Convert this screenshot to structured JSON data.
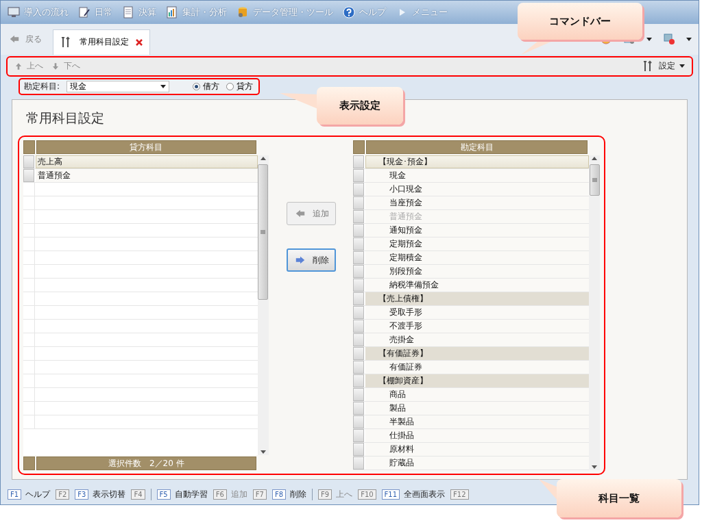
{
  "menu": [
    {
      "kind": "flow",
      "label": "導入の流れ"
    },
    {
      "kind": "daily",
      "label": "日常"
    },
    {
      "kind": "closing",
      "label": "決算"
    },
    {
      "kind": "report",
      "label": "集計・分析"
    },
    {
      "kind": "data",
      "label": "データ管理・ツール"
    },
    {
      "kind": "help",
      "label": "ヘルプ"
    },
    {
      "kind": "play",
      "label": "メニュー"
    }
  ],
  "back": {
    "label": "戻る",
    "disabled": true
  },
  "tab": {
    "label": "常用科目設定",
    "selected": true
  },
  "toolbar": {
    "items": [
      {
        "label": "上へ",
        "kind": "up",
        "disabled": true
      },
      {
        "label": "下へ",
        "kind": "down",
        "disabled": true
      }
    ],
    "settings": "設定"
  },
  "filter": {
    "label": "勘定科目:",
    "value": "現金",
    "radios": [
      {
        "label": "借方",
        "selected": true
      },
      {
        "label": "貸方",
        "selected": false
      }
    ]
  },
  "page_title": "常用科目設定",
  "left_grid": {
    "header": "貸方科目",
    "footer": "選択件数　2／20 件",
    "rows": [
      {
        "label": "売上高",
        "selected": true
      },
      {
        "label": "普通預金",
        "selected": false
      }
    ]
  },
  "actions": [
    {
      "label": "追加",
      "kind": "left",
      "disabled": true,
      "focused": false
    },
    {
      "label": "削除",
      "kind": "right",
      "disabled": false,
      "focused": true
    }
  ],
  "right_grid": {
    "header": "勘定科目",
    "rows": [
      {
        "label": "【現金･預金】",
        "kind": "group",
        "selected": true,
        "disabled": false
      },
      {
        "label": "現金",
        "kind": "account",
        "selected": false,
        "disabled": false
      },
      {
        "label": "小口現金",
        "kind": "account",
        "selected": false,
        "disabled": false
      },
      {
        "label": "当座預金",
        "kind": "account",
        "selected": false,
        "disabled": false
      },
      {
        "label": "普通預金",
        "kind": "account",
        "selected": false,
        "disabled": true
      },
      {
        "label": "通知預金",
        "kind": "account",
        "selected": false,
        "disabled": false
      },
      {
        "label": "定期預金",
        "kind": "account",
        "selected": false,
        "disabled": false
      },
      {
        "label": "定期積金",
        "kind": "account",
        "selected": false,
        "disabled": false
      },
      {
        "label": "別段預金",
        "kind": "account",
        "selected": false,
        "disabled": false
      },
      {
        "label": "納税準備預金",
        "kind": "account",
        "selected": false,
        "disabled": false
      },
      {
        "label": "【売上債権】",
        "kind": "group",
        "selected": false,
        "disabled": false
      },
      {
        "label": "受取手形",
        "kind": "account",
        "selected": false,
        "disabled": false
      },
      {
        "label": "不渡手形",
        "kind": "account",
        "selected": false,
        "disabled": false
      },
      {
        "label": "売掛金",
        "kind": "account",
        "selected": false,
        "disabled": false
      },
      {
        "label": "【有価証券】",
        "kind": "group",
        "selected": false,
        "disabled": false
      },
      {
        "label": "有価証券",
        "kind": "account",
        "selected": false,
        "disabled": false
      },
      {
        "label": "【棚卸資産】",
        "kind": "group",
        "selected": false,
        "disabled": false
      },
      {
        "label": "商品",
        "kind": "account",
        "selected": false,
        "disabled": false
      },
      {
        "label": "製品",
        "kind": "account",
        "selected": false,
        "disabled": false
      },
      {
        "label": "半製品",
        "kind": "account",
        "selected": false,
        "disabled": false
      },
      {
        "label": "仕掛品",
        "kind": "account",
        "selected": false,
        "disabled": false
      },
      {
        "label": "原材料",
        "kind": "account",
        "selected": false,
        "disabled": false
      },
      {
        "label": "貯蔵品",
        "kind": "account",
        "selected": false,
        "disabled": false
      }
    ]
  },
  "function_key_groups": [
    [
      {
        "key": "F1",
        "label": "ヘルプ",
        "disabled": false
      },
      {
        "key": "F2",
        "disabled": true
      },
      {
        "key": "F3",
        "label": "表示切替",
        "disabled": false
      },
      {
        "key": "F4",
        "disabled": true
      }
    ],
    [
      {
        "key": "F5",
        "label": "自動学習",
        "disabled": false
      },
      {
        "key": "F6",
        "label": "追加",
        "disabled": true
      },
      {
        "key": "F7",
        "disabled": true
      },
      {
        "key": "F8",
        "label": "削除",
        "disabled": false
      }
    ],
    [
      {
        "key": "F9",
        "label": "上へ",
        "disabled": true
      },
      {
        "key": "F10",
        "disabled": true
      },
      {
        "key": "F11",
        "label": "全画面表示",
        "disabled": false
      },
      {
        "key": "F12",
        "disabled": true
      }
    ]
  ],
  "callouts": [
    {
      "text": "コマンドバー"
    },
    {
      "text": "表示設定"
    },
    {
      "text": "科目一覧"
    }
  ]
}
